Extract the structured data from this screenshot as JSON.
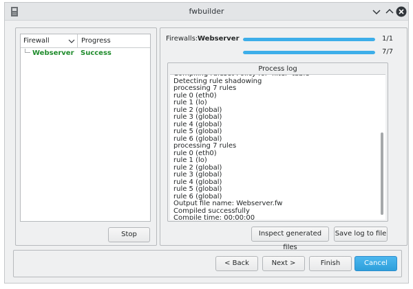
{
  "window": {
    "title": "fwbuilder"
  },
  "tree": {
    "columns": [
      "Firewall",
      "Progress"
    ],
    "rows": [
      {
        "name": "Webserver",
        "status": "Success"
      }
    ]
  },
  "left_panel": {
    "stop_label": "Stop"
  },
  "progress": {
    "firewalls_label": "Firewalls:",
    "current_firewall": "Webserver",
    "bar1": {
      "count": "1/1",
      "fraction": 1.0
    },
    "bar2": {
      "count": "7/7",
      "fraction": 1.0
    }
  },
  "process_log": {
    "title": "Process log",
    "lines": [
      "Compiling ruleset Policy for 'filter' table",
      "Detecting rule shadowing",
      "processing 7 rules",
      "rule 0 (eth0)",
      "rule 1 (lo)",
      "rule 2 (global)",
      "rule 3 (global)",
      "rule 4 (global)",
      "rule 5 (global)",
      "rule 6 (global)",
      "processing 7 rules",
      "rule 0 (eth0)",
      "rule 1 (lo)",
      "rule 2 (global)",
      "rule 3 (global)",
      "rule 4 (global)",
      "rule 5 (global)",
      "rule 6 (global)",
      "Output file name: Webserver.fw",
      "Compiled successfully",
      "Compile time: 00:00:00"
    ],
    "inspect_label": "Inspect generated files",
    "save_label": "Save log to file"
  },
  "navigation": {
    "back_label": "< Back",
    "next_label": "Next >",
    "finish_label": "Finish",
    "cancel_label": "Cancel"
  },
  "colors": {
    "accent": "#3daee9",
    "success": "#1e8b2b"
  }
}
